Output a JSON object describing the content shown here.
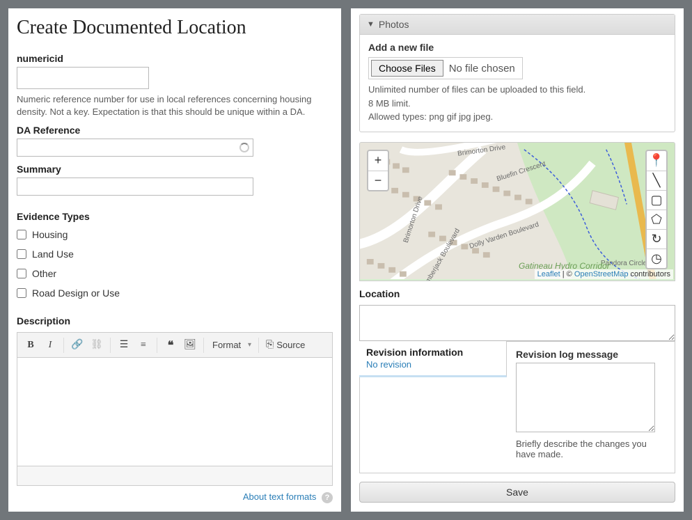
{
  "page_title": "Create Documented Location",
  "fields": {
    "numericid": {
      "label": "numericid",
      "help": "Numeric reference number for use in local references concerning housing density. Not a key. Expectation is that this should be unique within a DA."
    },
    "da_reference": {
      "label": "DA Reference"
    },
    "summary": {
      "label": "Summary"
    },
    "evidence_types": {
      "label": "Evidence Types",
      "options": [
        "Housing",
        "Land Use",
        "Other",
        "Road Design or Use"
      ]
    },
    "description": {
      "label": "Description"
    }
  },
  "editor": {
    "format_label": "Format",
    "source_label": "Source",
    "about_link": "About text formats"
  },
  "photos": {
    "header": "Photos",
    "add_label": "Add a new file",
    "choose_button": "Choose Files",
    "no_file": "No file chosen",
    "help1": "Unlimited number of files can be uploaded to this field.",
    "help2": "8 MB limit.",
    "help3": "Allowed types: png gif jpg jpeg."
  },
  "map": {
    "roads": [
      "Brimorton Drive",
      "Bluefin Crescent",
      "Dolly Varden Boulevard",
      "Amberjack Boulevard",
      "Brimorton Drive",
      "Pandora Circle"
    ],
    "park": "Gatineau Hydro Corridor",
    "attribution_leaflet": "Leaflet",
    "attribution_osm": "OpenStreetMap",
    "attribution_suffix": " contributors"
  },
  "location": {
    "label": "Location"
  },
  "revision": {
    "tab_title": "Revision information",
    "tab_sub": "No revision",
    "log_label": "Revision log message",
    "log_help": "Briefly describe the changes you have made."
  },
  "save_button": "Save"
}
